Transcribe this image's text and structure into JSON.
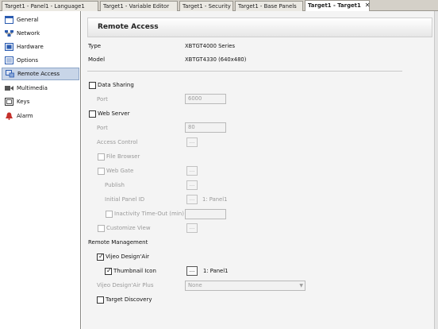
{
  "tabs": [
    {
      "label": "Target1 - Panel1 - Language1",
      "active": false
    },
    {
      "label": "Target1 - Variable Editor",
      "active": false
    },
    {
      "label": "Target1 - Security",
      "active": false
    },
    {
      "label": "Target1 - Base Panels",
      "active": false
    },
    {
      "label": "Target1 - Target1",
      "active": true
    }
  ],
  "tab_close_glyph": "✕",
  "sidebar": {
    "items": [
      {
        "label": "General",
        "icon": "general-icon"
      },
      {
        "label": "Network",
        "icon": "network-icon"
      },
      {
        "label": "Hardware",
        "icon": "hardware-icon"
      },
      {
        "label": "Options",
        "icon": "options-icon"
      },
      {
        "label": "Remote Access",
        "icon": "remote-access-icon",
        "selected": true
      },
      {
        "label": "Multimedia",
        "icon": "multimedia-icon"
      },
      {
        "label": "Keys",
        "icon": "keys-icon"
      },
      {
        "label": "Alarm",
        "icon": "alarm-icon"
      }
    ]
  },
  "header": {
    "title": "Remote Access"
  },
  "info": {
    "type_label": "Type",
    "type_value": "XBTGT4000 Series",
    "model_label": "Model",
    "model_value": "XBTGT4330 (640x480)"
  },
  "data_sharing": {
    "label": "Data Sharing",
    "checked": false,
    "port_label": "Port",
    "port_value": "6000"
  },
  "web_server": {
    "label": "Web Server",
    "checked": false,
    "port_label": "Port",
    "port_value": "80",
    "access_control_label": "Access Control",
    "file_browser_label": "File Browser",
    "web_gate_label": "Web Gate",
    "publish_label": "Publish",
    "initial_panel_label": "Initial Panel ID",
    "initial_panel_value": "1: Panel1",
    "inactivity_label": "Inactivity Time-Out (min)",
    "customize_view_label": "Customize View",
    "ellipsis": "..."
  },
  "remote_management": {
    "heading": "Remote Management",
    "vijeo_air_label": "Vijeo Design'Air",
    "vijeo_air_checked": true,
    "thumbnail_label": "Thumbnail Icon",
    "thumbnail_checked": true,
    "thumbnail_value": "1: Panel1",
    "vijeo_plus_label": "Vijeo Design'Air Plus",
    "vijeo_plus_value": "None",
    "target_discovery_label": "Target Discovery",
    "target_discovery_checked": false,
    "check_glyph": "✓",
    "dropdown_glyph": "▼"
  },
  "colors": {
    "selection_bg": "#c8d5e8",
    "panel_bg": "#f4f4f4",
    "disabled_text": "#9a9a9a"
  }
}
